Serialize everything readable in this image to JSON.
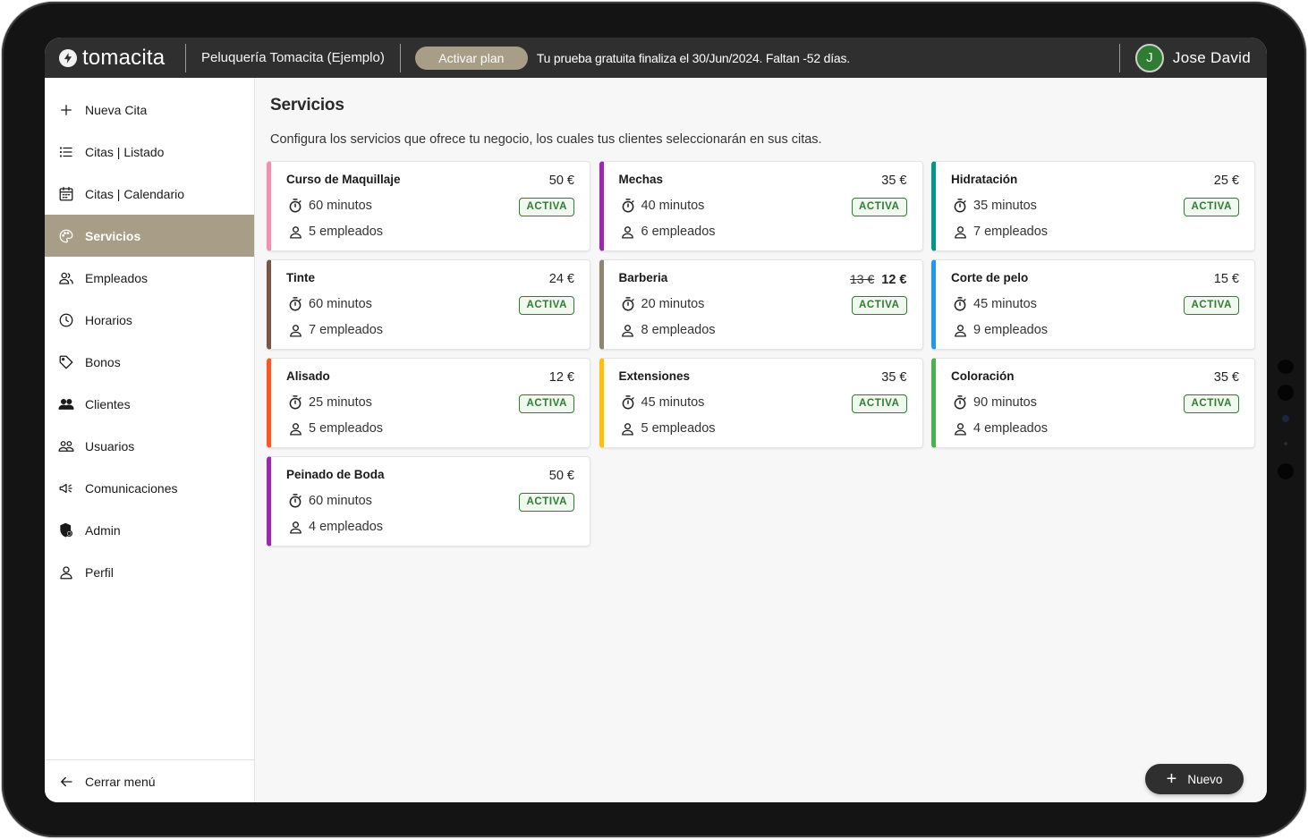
{
  "app": {
    "brand": "tomacita"
  },
  "header": {
    "business_name": "Peluquería Tomacita (Ejemplo)",
    "plan_button": "Activar plan",
    "trial_message": "Tu prueba gratuita finaliza el 30/Jun/2024. Faltan -52 días.",
    "user_initial": "J",
    "user_name": "Jose David"
  },
  "sidebar": {
    "items": [
      {
        "label": "Nueva Cita",
        "icon": "plus-icon"
      },
      {
        "label": "Citas | Listado",
        "icon": "list-icon"
      },
      {
        "label": "Citas | Calendario",
        "icon": "calendar-icon"
      },
      {
        "label": "Servicios",
        "icon": "palette-icon",
        "active": true
      },
      {
        "label": "Empleados",
        "icon": "employees-icon"
      },
      {
        "label": "Horarios",
        "icon": "clock-icon"
      },
      {
        "label": "Bonos",
        "icon": "tag-icon"
      },
      {
        "label": "Clientes",
        "icon": "people-icon"
      },
      {
        "label": "Usuarios",
        "icon": "users-icon"
      },
      {
        "label": "Comunicaciones",
        "icon": "megaphone-icon"
      },
      {
        "label": "Admin",
        "icon": "admin-shield-icon"
      },
      {
        "label": "Perfil",
        "icon": "person-icon"
      }
    ],
    "close_menu": "Cerrar menú"
  },
  "main": {
    "title": "Servicios",
    "description": "Configura los servicios que ofrece tu negocio, los cuales tus clientes seleccionarán en sus citas.",
    "new_button": "Nuevo",
    "services": [
      {
        "name": "Curso de Maquillaje",
        "price": "50 €",
        "old_price": "",
        "duration": "60 minutos",
        "employees": "5 empleados",
        "status": "ACTIVA",
        "color": "#f48fb1"
      },
      {
        "name": "Mechas",
        "price": "35 €",
        "old_price": "",
        "duration": "40 minutos",
        "employees": "6 empleados",
        "status": "ACTIVA",
        "color": "#9c27b0"
      },
      {
        "name": "Hidratación",
        "price": "25 €",
        "old_price": "",
        "duration": "35 minutos",
        "employees": "7 empleados",
        "status": "ACTIVA",
        "color": "#009688"
      },
      {
        "name": "Tinte",
        "price": "24 €",
        "old_price": "",
        "duration": "60 minutos",
        "employees": "7 empleados",
        "status": "ACTIVA",
        "color": "#795548"
      },
      {
        "name": "Barberia",
        "price": "12 €",
        "old_price": "13 €",
        "duration": "20 minutos",
        "employees": "8 empleados",
        "status": "ACTIVA",
        "color": "#8d8472"
      },
      {
        "name": "Corte de pelo",
        "price": "15 €",
        "old_price": "",
        "duration": "45 minutos",
        "employees": "9 empleados",
        "status": "ACTIVA",
        "color": "#2196f3"
      },
      {
        "name": "Alisado",
        "price": "12 €",
        "old_price": "",
        "duration": "25 minutos",
        "employees": "5 empleados",
        "status": "ACTIVA",
        "color": "#ff5722"
      },
      {
        "name": "Extensiones",
        "price": "35 €",
        "old_price": "",
        "duration": "45 minutos",
        "employees": "5 empleados",
        "status": "ACTIVA",
        "color": "#ffc107"
      },
      {
        "name": "Coloración",
        "price": "35 €",
        "old_price": "",
        "duration": "90 minutos",
        "employees": "4 empleados",
        "status": "ACTIVA",
        "color": "#4caf50"
      },
      {
        "name": "Peinado de Boda",
        "price": "50 €",
        "old_price": "",
        "duration": "60 minutos",
        "employees": "4 empleados",
        "status": "ACTIVA",
        "color": "#9c27b0"
      }
    ]
  },
  "colors": {
    "accent": "#a89d86",
    "topbar": "#2f2f2f",
    "active_badge": "#2e7d32"
  }
}
